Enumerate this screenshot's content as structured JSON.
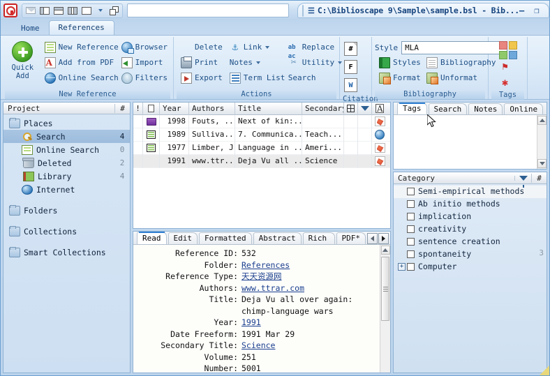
{
  "window": {
    "title": "C:\\Biblioscape 9\\Sample\\sample.bsl - Bib...",
    "caret": "☰",
    "minimize": "–",
    "maximize": "❐",
    "restore": "☷",
    "close": "✕"
  },
  "quick_access": {
    "logo": "biblioscape-logo",
    "buttons": [
      {
        "name": "envelope-icon",
        "label": ""
      },
      {
        "name": "layout-left-pane-icon",
        "label": ""
      },
      {
        "name": "layout-top-pane-icon",
        "label": ""
      },
      {
        "name": "layout-split-icon",
        "label": ""
      },
      {
        "name": "layout-single-icon",
        "label": ""
      },
      {
        "name": "dropdown-caret-icon",
        "label": ""
      },
      {
        "name": "windows-stack-icon",
        "label": ""
      }
    ],
    "address_value": ""
  },
  "ribbon": {
    "tabs": [
      {
        "label": "Home",
        "active": false
      },
      {
        "label": "References",
        "active": true
      }
    ],
    "groups": [
      {
        "caption": "New Reference",
        "big_button": {
          "label_line1": "Quick",
          "label_line2": "Add",
          "icon": "green-plus-icon"
        },
        "col1": [
          {
            "label": "New Reference",
            "icon": "list-icon",
            "dropdown": true
          },
          {
            "label": "Add from PDF",
            "icon": "pdf-icon",
            "dropdown": false
          },
          {
            "label": "Online Search",
            "icon": "globe-icon",
            "dropdown": false
          }
        ],
        "col2": [
          {
            "label": "Browser",
            "icon": "browser-icon",
            "dropdown": false
          },
          {
            "label": "Import",
            "icon": "import-icon",
            "dropdown": false
          },
          {
            "label": "Filters",
            "icon": "filter-icon",
            "dropdown": false
          }
        ]
      },
      {
        "caption": "Actions",
        "col1": [
          {
            "label": "Delete",
            "icon": "none",
            "dropdown": false
          },
          {
            "label": "Print",
            "icon": "printer-icon",
            "dropdown": false
          },
          {
            "label": "Export",
            "icon": "export-icon",
            "dropdown": false
          }
        ],
        "col2": [
          {
            "label": "Link",
            "icon": "anchor-icon",
            "dropdown": true
          },
          {
            "label": "Notes",
            "icon": "none",
            "dropdown": true
          },
          {
            "label": "Term List",
            "icon": "term-list-icon",
            "dropdown": false
          }
        ],
        "col3": [
          {
            "label": "Replace",
            "icon": "replace-icon",
            "dropdown": false
          },
          {
            "label": "Utility",
            "icon": "utility-icon",
            "dropdown": true
          },
          {
            "label": "Search",
            "icon": "none",
            "dropdown": false
          }
        ]
      },
      {
        "caption": "Citation",
        "items": [
          {
            "glyph": "#",
            "name": "citation-number-icon",
            "dropdown": true
          },
          {
            "glyph": "F",
            "name": "citation-field-icon",
            "dropdown": true
          },
          {
            "glyph": "W",
            "name": "citation-word-icon",
            "dropdown": true
          }
        ]
      },
      {
        "caption": "Bibliography",
        "style_label": "Style",
        "style_value": "MLA",
        "col1": [
          {
            "label": "Styles",
            "icon": "book-icon"
          },
          {
            "label": "Format",
            "icon": "format-icon"
          }
        ],
        "col2": [
          {
            "label": "Bibliography",
            "icon": "document-icon"
          },
          {
            "label": "Unformat",
            "icon": "unformat-icon"
          }
        ]
      },
      {
        "caption": "Tags",
        "items": [
          {
            "name": "color-tags-grid-icon",
            "dropdown": false
          },
          {
            "name": "flag-icon",
            "dropdown": true
          },
          {
            "name": "priority-icon",
            "dropdown": true
          }
        ]
      }
    ]
  },
  "project_panel": {
    "header": {
      "title": "Project",
      "count_col": "#"
    },
    "nodes": [
      {
        "label": "Places",
        "icon": "folder-icon",
        "level": 0,
        "count": "",
        "selected": false
      },
      {
        "label": "Search",
        "icon": "search-icon",
        "level": 1,
        "count": "4",
        "selected": true
      },
      {
        "label": "Online Search",
        "icon": "online-search-icon",
        "level": 1,
        "count": "0",
        "selected": false
      },
      {
        "label": "Deleted",
        "icon": "trash-icon",
        "level": 1,
        "count": "2",
        "selected": false
      },
      {
        "label": "Library",
        "icon": "library-book-icon",
        "level": 1,
        "count": "4",
        "selected": false
      },
      {
        "label": "Internet",
        "icon": "internet-globe-icon",
        "level": 1,
        "count": "",
        "selected": false
      },
      {
        "label": "Folders",
        "icon": "folder-icon",
        "level": 0,
        "count": "",
        "selected": false
      },
      {
        "label": "Collections",
        "icon": "folder-icon",
        "level": 0,
        "count": "",
        "selected": false
      },
      {
        "label": "Smart Collections",
        "icon": "folder-icon",
        "level": 0,
        "count": "",
        "selected": false
      }
    ]
  },
  "reference_list": {
    "columns": [
      {
        "label": "!",
        "name": "priority-column"
      },
      {
        "label": "",
        "name": "type-column"
      },
      {
        "label": "Year",
        "name": "year-column"
      },
      {
        "label": "Authors",
        "name": "authors-column"
      },
      {
        "label": "Title",
        "name": "title-column"
      },
      {
        "label": "Secondary",
        "name": "secondary-column"
      },
      {
        "label": "",
        "name": "grid-column"
      },
      {
        "label": "",
        "name": "filter-column"
      },
      {
        "label": "",
        "name": "attachment-column"
      }
    ],
    "rows": [
      {
        "type_icon": "book-purple-icon",
        "year": "1998",
        "authors": "Fouts, ...",
        "title": "Next of kin:...",
        "secondary": "",
        "attach_icon": "pdf-icon",
        "selected": false
      },
      {
        "type_icon": "card-icon",
        "year": "1989",
        "authors": "Sulliva...",
        "title": "7. Communica...",
        "secondary": "Teach...",
        "attach_icon": "globe-icon",
        "selected": false
      },
      {
        "type_icon": "card-icon",
        "year": "1977",
        "authors": "Limber, J.",
        "title": "Language in ...",
        "secondary": "Ameri...",
        "attach_icon": "pdf-icon",
        "selected": false
      },
      {
        "type_icon": "none",
        "year": "1991",
        "authors": "www.ttr...",
        "title": "Deja Vu all ...",
        "secondary": "Science",
        "attach_icon": "pdf-icon",
        "selected": true
      }
    ]
  },
  "detail_panel": {
    "tabs": [
      {
        "label": "Read",
        "active": true
      },
      {
        "label": "Edit",
        "active": false
      },
      {
        "label": "Formatted",
        "active": false
      },
      {
        "label": "Abstract",
        "active": false
      },
      {
        "label": "Rich Text",
        "active": false
      },
      {
        "label": "PDF*",
        "active": false
      }
    ],
    "nav_prev": "prev-tab-arrow",
    "nav_next": "next-tab-arrow",
    "fields": [
      {
        "key": "Reference ID:",
        "value": "532",
        "link": false
      },
      {
        "key": "Folder:",
        "value": "References",
        "link": true
      },
      {
        "key": "Reference Type:",
        "value": "天天资源网",
        "link": true,
        "cjk": true
      },
      {
        "key": "Authors:",
        "value": "www.ttrar.com",
        "link": true
      },
      {
        "key": "Title:",
        "value": "Deja Vu all over again: chimp-language wars",
        "link": false
      },
      {
        "key": "Year:",
        "value": "1991",
        "link": true
      },
      {
        "key": "Date Freeform:",
        "value": "1991 Mar 29",
        "link": false
      },
      {
        "key": "Secondary Title:",
        "value": "Science",
        "link": true
      },
      {
        "key": "Volume:",
        "value": "251",
        "link": false
      },
      {
        "key": "Number:",
        "value": "5001",
        "link": false
      }
    ]
  },
  "right_panel": {
    "tabs": [
      {
        "label": "Tags",
        "active": true
      },
      {
        "label": "Search",
        "active": false
      },
      {
        "label": "Notes",
        "active": false
      },
      {
        "label": "Online",
        "active": false
      }
    ],
    "category": {
      "header": {
        "title": "Category",
        "filter_icon": "funnel-icon",
        "count_col": "#"
      },
      "items": [
        {
          "label": "Semi-empirical methods",
          "checked": false,
          "count": "",
          "expandable": false
        },
        {
          "label": "Ab initio methods",
          "checked": false,
          "count": "",
          "expandable": false
        },
        {
          "label": "implication",
          "checked": false,
          "count": "",
          "expandable": false
        },
        {
          "label": "creativity",
          "checked": false,
          "count": "",
          "expandable": false
        },
        {
          "label": "sentence creation",
          "checked": false,
          "count": "",
          "expandable": false
        },
        {
          "label": "spontaneity",
          "checked": false,
          "count": "3",
          "expandable": false
        },
        {
          "label": "Computer",
          "checked": false,
          "count": "",
          "expandable": true,
          "expander": "+"
        }
      ]
    }
  },
  "colors": {
    "accent": "#2f7fd1",
    "ribbon_text": "#1c4e85",
    "selection": "#a9c5e3",
    "link": "#1b3f8f"
  }
}
